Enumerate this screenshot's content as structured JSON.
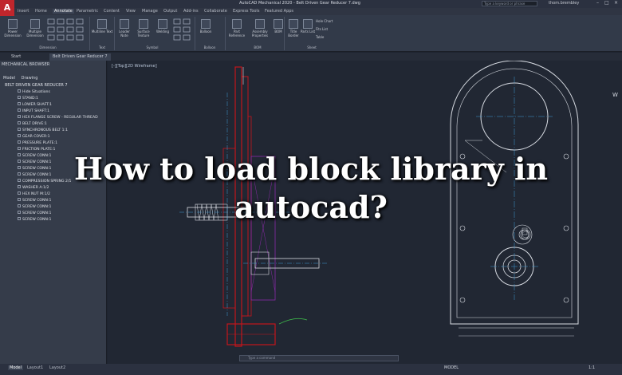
{
  "app": {
    "logo": "A",
    "title": "AutoCAD Mechanical 2020 - Belt Driven Gear Reducer 7.dwg",
    "search_placeholder": "Type a keyword or phrase",
    "user": "thom.brembley"
  },
  "ribbon_tabs": [
    "Insert",
    "Home",
    "Annotate",
    "Parametric",
    "Content",
    "View",
    "Manage",
    "Output",
    "Add-ins",
    "Collaborate",
    "Express Tools",
    "Featured Apps"
  ],
  "ribbon_active": "Annotate",
  "ribbon": {
    "buttons": [
      "Power Dimension",
      "Multiple Dimension",
      "Multiline Text",
      "Leader Note",
      "Surface Texture",
      "Welding",
      "Balloon",
      "Part Reference",
      "Assembly Properties",
      "BOM",
      "Title Border",
      "Parts List"
    ],
    "small_buttons": [
      "Hole Chart",
      "Fits List",
      "Table"
    ],
    "groups": [
      "Dimension",
      "Text",
      "Symbol",
      "Balloon",
      "BOM",
      "Sheet"
    ]
  },
  "doc_tabs": [
    "Start",
    "Belt Driven Gear Reducer 7"
  ],
  "browser": {
    "title": "MECHANICAL BROWSER",
    "tabs": [
      "Model",
      "Drawing"
    ],
    "root": "BELT DRIVEN GEAR REDUCER 7",
    "items": [
      "Hide Situations",
      "STAND:1",
      "LOWER SHAFT:1",
      "INPUT SHAFT:1",
      "HEX FLANGE SCREW - REGULAR THREAD",
      "BELT DRIVE:1",
      "SYNCHRONOUS BELT 1:1",
      "GEAR COVER:1",
      "PRESSURE PLATE:1",
      "FRICTION PLATE:1",
      "SCREW CONN:1",
      "SCREW CONN:1",
      "SCREW CONN:1",
      "SCREW CONN:1",
      "COMPRESSION SPRING 2/1",
      "WASHER A:1/2",
      "HEX NUT M:1/2",
      "SCREW CONN:1",
      "SCREW CONN:1",
      "SCREW CONN:1",
      "SCREW CONN:1"
    ]
  },
  "viewport_label": "[-][Top][2D Wireframe]",
  "command_placeholder": "Type a command",
  "layout_tabs": [
    "Model",
    "Layout1",
    "Layout2"
  ],
  "status": {
    "model": "MODEL",
    "zoom": "1:1"
  },
  "headline": "How to load block library in autocad?",
  "colors": {
    "logo_red": "#c0262c",
    "canvas_bg": "#212733",
    "drawing_red": "#c3161c"
  }
}
